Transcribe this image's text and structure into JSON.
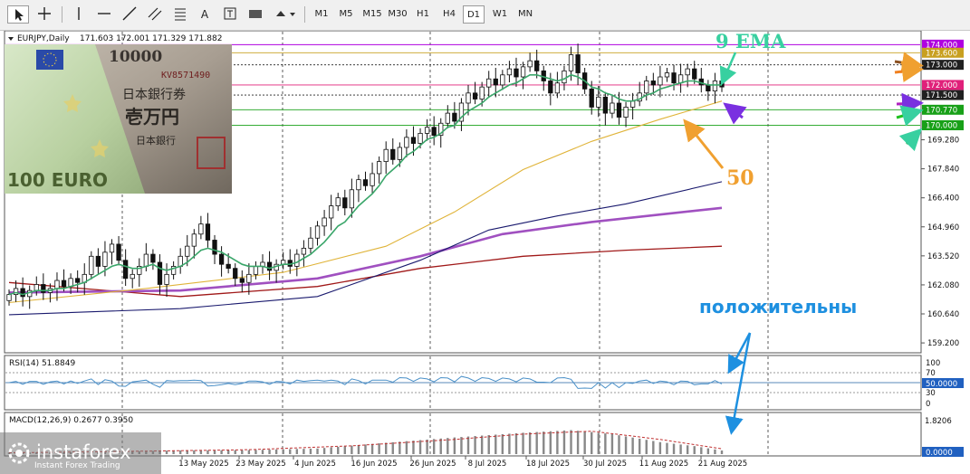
{
  "toolbar": {
    "text_tool": "A",
    "timeframes": [
      "M1",
      "M5",
      "M15",
      "M30",
      "H1",
      "H4",
      "D1",
      "W1",
      "MN"
    ],
    "active_timeframe": "D1"
  },
  "header": {
    "symbol": "EURJPY,Daily",
    "quote": "171.603 172.001 171.329 171.882"
  },
  "banknote": {
    "euro_label": "100 EURO",
    "yen_number": "10000",
    "yen_serial": "KV8571490",
    "yen_line1": "日本銀行券",
    "yen_line2": "壱万円",
    "yen_line3": "日本銀行"
  },
  "annotations": {
    "ema_label": "9 EMA",
    "ma_label": "50",
    "positive_label": "положительны"
  },
  "logo": {
    "name": "instaforex",
    "tagline": "Instant Forex Trading"
  },
  "colors": {
    "ema9": "#3aa66a",
    "ma50": "#e0b43a",
    "ma100": "#1a1a6e",
    "ma150": "#a050c0",
    "ma200": "#a01818",
    "annotation_green": "#38d0a0",
    "annotation_orange": "#f0a030",
    "annotation_blue": "#1e90e0",
    "rsi_line": "#4a90c8",
    "macd_hist": "#888888",
    "macd_signal": "#c03030"
  },
  "chart_data": {
    "type": "candlestick",
    "symbol": "EURJPY",
    "timeframe": "Daily",
    "price_axis": {
      "ticks": [
        "159.200",
        "160.640",
        "162.080",
        "163.520",
        "164.960",
        "166.400",
        "167.840",
        "169.280"
      ],
      "ylim": [
        158.8,
        174.6
      ]
    },
    "level_labels": [
      {
        "value": 174.0,
        "label": "174.000",
        "color": "#b000e0"
      },
      {
        "value": 173.6,
        "label": "173.600",
        "color": "#c8a020"
      },
      {
        "value": 173.0,
        "label": "173.000",
        "color": "#202020"
      },
      {
        "value": 172.0,
        "label": "172.000",
        "color": "#e0207a"
      },
      {
        "value": 171.5,
        "label": "171.500",
        "color": "#202020"
      },
      {
        "value": 170.77,
        "label": "170.770",
        "color": "#18a018"
      },
      {
        "value": 170.0,
        "label": "170.000",
        "color": "#18a018"
      }
    ],
    "date_labels": [
      "13 May 2025",
      "23 May 2025",
      "4 Jun 2025",
      "16 Jun 2025",
      "26 Jun 2025",
      "8 Jul 2025",
      "18 Jul 2025",
      "30 Jul 2025",
      "11 Aug 2025",
      "21 Aug 2025"
    ],
    "closes": [
      161.6,
      161.9,
      161.5,
      161.8,
      162.1,
      161.7,
      161.9,
      162.3,
      162.0,
      162.4,
      162.2,
      162.6,
      163.5,
      163.0,
      163.7,
      164.1,
      163.3,
      162.4,
      162.6,
      163.0,
      163.6,
      163.2,
      162.1,
      162.6,
      163.0,
      163.5,
      164.0,
      164.6,
      165.1,
      164.3,
      163.6,
      163.1,
      162.9,
      162.4,
      162.2,
      162.6,
      163.0,
      163.2,
      162.8,
      163.1,
      163.3,
      163.0,
      163.6,
      163.9,
      164.4,
      165.0,
      165.4,
      166.0,
      166.4,
      165.9,
      166.8,
      167.3,
      167.0,
      167.6,
      168.2,
      168.8,
      168.3,
      168.9,
      169.4,
      169.1,
      169.6,
      169.9,
      169.5,
      170.1,
      170.6,
      170.2,
      171.1,
      171.6,
      171.3,
      171.9,
      172.3,
      172.0,
      172.5,
      172.8,
      172.4,
      172.9,
      173.2,
      172.7,
      172.2,
      171.6,
      172.1,
      172.7,
      173.5,
      172.6,
      171.8,
      170.9,
      171.4,
      170.6,
      171.1,
      170.4,
      170.9,
      171.2,
      171.6,
      172.2,
      172.0,
      172.4,
      172.6,
      172.1,
      172.5,
      172.8,
      172.3,
      172.0,
      171.7,
      172.2,
      171.9
    ],
    "ema9": [
      161.6,
      161.7,
      161.6,
      161.7,
      161.8,
      161.8,
      161.8,
      161.9,
      161.9,
      162.0,
      162.1,
      162.2,
      162.4,
      162.6,
      162.8,
      163.0,
      163.1,
      163.0,
      162.9,
      162.9,
      163.0,
      163.1,
      162.9,
      162.8,
      162.9,
      163.0,
      163.2,
      163.5,
      163.8,
      163.9,
      163.8,
      163.7,
      163.5,
      163.3,
      163.1,
      163.0,
      163.0,
      163.0,
      162.9,
      163.0,
      163.1,
      163.1,
      163.2,
      163.4,
      163.6,
      163.9,
      164.2,
      164.6,
      165.0,
      165.2,
      165.6,
      166.0,
      166.3,
      166.6,
      167.0,
      167.5,
      167.8,
      168.1,
      168.5,
      168.7,
      169.0,
      169.3,
      169.4,
      169.6,
      169.9,
      170.0,
      170.4,
      170.7,
      170.9,
      171.1,
      171.4,
      171.6,
      171.8,
      172.0,
      172.1,
      172.3,
      172.5,
      172.5,
      172.4,
      172.3,
      172.2,
      172.3,
      172.5,
      172.4,
      172.2,
      171.9,
      171.8,
      171.6,
      171.5,
      171.3,
      171.2,
      171.2,
      171.3,
      171.5,
      171.6,
      171.8,
      171.9,
      172.0,
      172.1,
      172.2,
      172.2,
      172.1,
      172.0,
      172.0,
      172.0
    ],
    "ma50_points": [
      [
        0,
        161.2
      ],
      [
        20,
        161.9
      ],
      [
        40,
        162.7
      ],
      [
        55,
        164.0
      ],
      [
        65,
        165.7
      ],
      [
        75,
        167.8
      ],
      [
        85,
        169.2
      ],
      [
        95,
        170.3
      ],
      [
        104,
        171.2
      ]
    ],
    "ma100_points": [
      [
        0,
        160.6
      ],
      [
        25,
        160.9
      ],
      [
        45,
        161.5
      ],
      [
        60,
        163.3
      ],
      [
        70,
        164.8
      ],
      [
        80,
        165.5
      ],
      [
        90,
        166.1
      ],
      [
        104,
        167.2
      ]
    ],
    "ma150_points": [
      [
        0,
        161.7
      ],
      [
        25,
        161.8
      ],
      [
        45,
        162.4
      ],
      [
        60,
        163.5
      ],
      [
        72,
        164.6
      ],
      [
        85,
        165.2
      ],
      [
        104,
        165.9
      ]
    ],
    "ma200_points": [
      [
        0,
        162.2
      ],
      [
        25,
        161.5
      ],
      [
        45,
        162.0
      ],
      [
        60,
        162.9
      ],
      [
        75,
        163.5
      ],
      [
        90,
        163.8
      ],
      [
        104,
        164.0
      ]
    ],
    "rsi": {
      "label": "RSI(14) 51.8849",
      "value_label": "50.0000",
      "ticks": [
        "100",
        "70",
        "30",
        "0"
      ],
      "ylim": [
        0,
        100
      ]
    },
    "macd": {
      "label": "MACD(12,26,9) 0.2677 0.3950",
      "max_label": "1.8206",
      "min_label": "0.0000",
      "hist_points": [
        [
          0,
          0.12
        ],
        [
          15,
          0.18
        ],
        [
          25,
          0.28
        ],
        [
          35,
          0.3
        ],
        [
          45,
          0.42
        ],
        [
          55,
          0.85
        ],
        [
          65,
          1.25
        ],
        [
          75,
          1.6
        ],
        [
          82,
          1.8
        ],
        [
          88,
          1.5
        ],
        [
          95,
          0.9
        ],
        [
          100,
          0.6
        ],
        [
          104,
          0.27
        ]
      ],
      "signal_points": [
        [
          0,
          0.1
        ],
        [
          20,
          0.22
        ],
        [
          35,
          0.33
        ],
        [
          50,
          0.62
        ],
        [
          65,
          1.1
        ],
        [
          75,
          1.5
        ],
        [
          85,
          1.72
        ],
        [
          95,
          1.1
        ],
        [
          104,
          0.4
        ]
      ],
      "ylim": [
        0,
        1.9
      ]
    }
  }
}
